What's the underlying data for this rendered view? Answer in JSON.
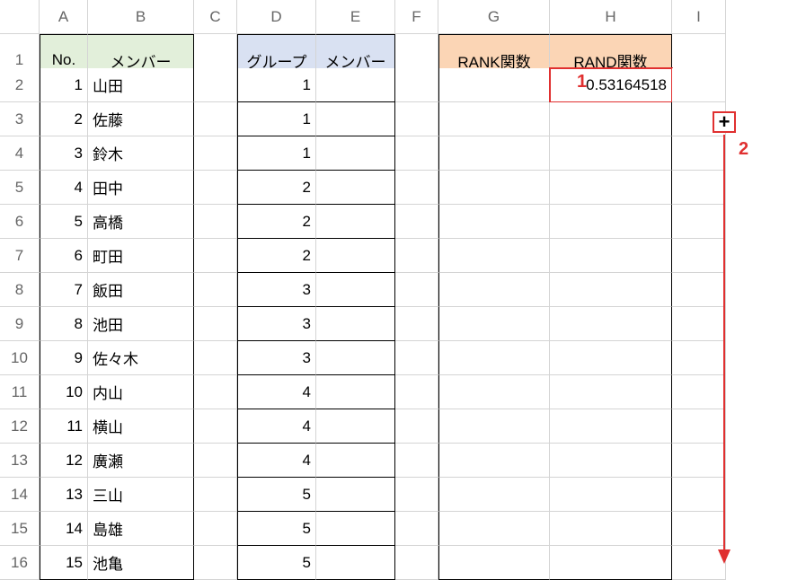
{
  "columns": [
    "A",
    "B",
    "C",
    "D",
    "E",
    "F",
    "G",
    "H",
    "I"
  ],
  "row_numbers": [
    1,
    2,
    3,
    4,
    5,
    6,
    7,
    8,
    9,
    10,
    11,
    12,
    13,
    14,
    15,
    16
  ],
  "headers": {
    "A1": "No.",
    "B1": "メンバー",
    "D1": "グループ",
    "E1": "メンバー",
    "G1": "RANK関数",
    "H1": "RAND関数"
  },
  "table_AB": [
    {
      "no": 1,
      "name": "山田"
    },
    {
      "no": 2,
      "name": "佐藤"
    },
    {
      "no": 3,
      "name": "鈴木"
    },
    {
      "no": 4,
      "name": "田中"
    },
    {
      "no": 5,
      "name": "高橋"
    },
    {
      "no": 6,
      "name": "町田"
    },
    {
      "no": 7,
      "name": "飯田"
    },
    {
      "no": 8,
      "name": "池田"
    },
    {
      "no": 9,
      "name": "佐々木"
    },
    {
      "no": 10,
      "name": "内山"
    },
    {
      "no": 11,
      "name": "横山"
    },
    {
      "no": 12,
      "name": "廣瀬"
    },
    {
      "no": 13,
      "name": "三山"
    },
    {
      "no": 14,
      "name": "島雄"
    },
    {
      "no": 15,
      "name": "池亀"
    }
  ],
  "table_D_groups": [
    1,
    1,
    1,
    2,
    2,
    2,
    3,
    3,
    3,
    4,
    4,
    4,
    5,
    5,
    5
  ],
  "H2_value": "0.53164518",
  "callouts": {
    "one": "1",
    "two": "2"
  },
  "fill_handle_glyph": "+"
}
